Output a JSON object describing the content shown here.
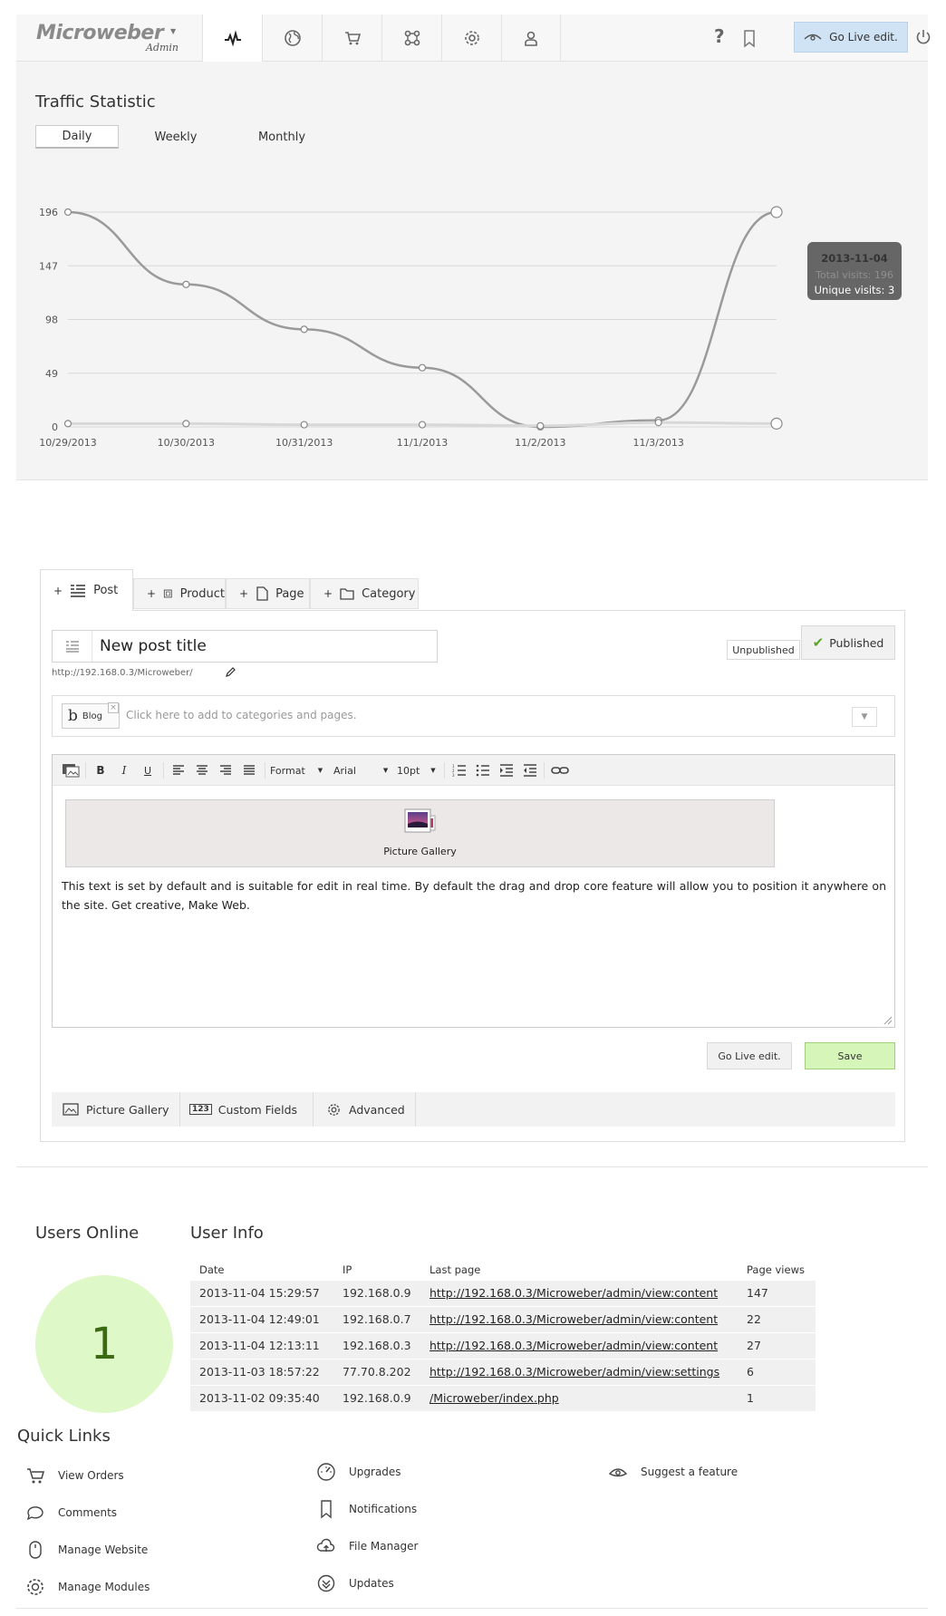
{
  "topbar": {
    "logo": "Microweber",
    "logo_sub": "Admin",
    "nav_icons": [
      "pulse-icon",
      "globe-icon",
      "cart-icon",
      "modules-icon",
      "gear-icon",
      "user-icon"
    ],
    "help": "?",
    "golive_label": "Go Live edit."
  },
  "traffic": {
    "title": "Traffic Statistic",
    "tabs": [
      "Daily",
      "Weekly",
      "Monthly"
    ],
    "active_tab": "Daily",
    "tooltip": {
      "date": "2013-11-04",
      "total": "Total visits: 196",
      "unique": "Unique visits: 3"
    }
  },
  "chart_data": {
    "type": "line",
    "title": "",
    "xlabel": "",
    "ylabel": "",
    "ylim": [
      0,
      196
    ],
    "y_ticks": [
      "196",
      "147",
      "98",
      "49",
      "0"
    ],
    "categories": [
      "10/29/2013",
      "10/30/2013",
      "10/31/2013",
      "11/1/2013",
      "11/2/2013",
      "11/3/2013",
      "11/4/2013"
    ],
    "x_tick_labels": [
      "10/29/2013",
      "10/30/2013",
      "10/31/2013",
      "11/1/2013",
      "11/2/2013",
      "11/3/2013"
    ],
    "series": [
      {
        "values": [
          196,
          130,
          89,
          54,
          0,
          6,
          196
        ],
        "color": "#9a9a9a"
      },
      {
        "values": [
          3,
          3,
          2,
          2,
          1,
          4,
          3
        ],
        "color": "#d8d8d8"
      }
    ],
    "grid": true
  },
  "content_types": [
    {
      "label": "Post",
      "icon": "post-icon"
    },
    {
      "label": "Product",
      "icon": "product-icon"
    },
    {
      "label": "Page",
      "icon": "page-icon"
    },
    {
      "label": "Category",
      "icon": "folder-icon"
    }
  ],
  "editor": {
    "title_value": "New post title",
    "url": "http://192.168.0.3/Microweber/",
    "status_unpublished": "Unpublished",
    "status_published": "Published",
    "category_tag": "Blog",
    "category_placeholder": "Click here to add to categories and pages.",
    "toolbar": {
      "format": "Format",
      "font": "Arial",
      "size": "10pt"
    },
    "gallery_label": "Picture Gallery",
    "body_text": "This text is set by default and is suitable for edit in real time. By default the drag and drop core feature will allow you to position it anywhere on the site. Get creative, Make Web.",
    "golive_label": "Go Live edit.",
    "save_label": "Save",
    "bottom_tabs": [
      "Picture Gallery",
      "Custom Fields",
      "Advanced"
    ],
    "custom_fields_icon_text": "123"
  },
  "users_online": {
    "title": "Users Online",
    "count": "1"
  },
  "user_info": {
    "title": "User Info",
    "columns": [
      "Date",
      "IP",
      "Last page",
      "Page views"
    ],
    "rows": [
      [
        "2013-11-04 15:29:57",
        "192.168.0.9",
        "http://192.168.0.3/Microweber/admin/view:content",
        "147"
      ],
      [
        "2013-11-04 12:49:01",
        "192.168.0.7",
        "http://192.168.0.3/Microweber/admin/view:content",
        "22"
      ],
      [
        "2013-11-04 12:13:11",
        "192.168.0.3",
        "http://192.168.0.3/Microweber/admin/view:content",
        "27"
      ],
      [
        "2013-11-03 18:57:22",
        "77.70.8.202",
        "http://192.168.0.3/Microweber/admin/view:settings",
        "6"
      ],
      [
        "2013-11-02 09:35:40",
        "192.168.0.9",
        "/Microweber/index.php",
        "1"
      ]
    ]
  },
  "quick_links": {
    "title": "Quick Links",
    "col1": [
      "View Orders",
      "Comments",
      "Manage Website",
      "Manage Modules"
    ],
    "col2": [
      "Upgrades",
      "Notifications",
      "File Manager",
      "Updates"
    ],
    "col3": [
      "Suggest a feature"
    ]
  },
  "colors": {
    "accent_blue": "#cfe3f5",
    "online_green": "#dff8c8",
    "save_green": "#d6f5b8",
    "count_green": "#3a6b10"
  }
}
